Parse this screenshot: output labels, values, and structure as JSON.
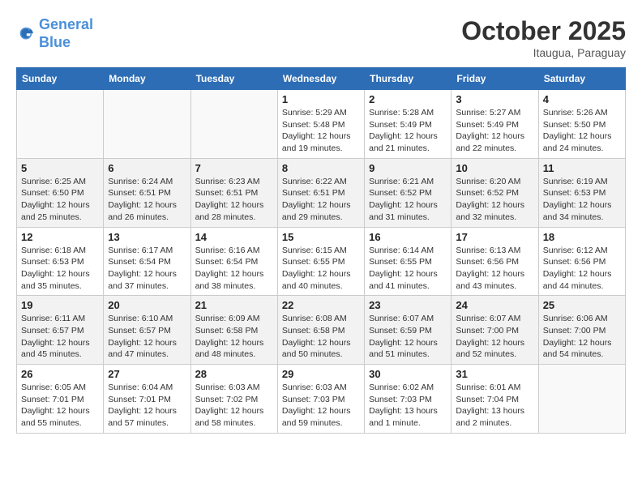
{
  "header": {
    "logo_line1": "General",
    "logo_line2": "Blue",
    "month": "October 2025",
    "location": "Itaugua, Paraguay"
  },
  "weekdays": [
    "Sunday",
    "Monday",
    "Tuesday",
    "Wednesday",
    "Thursday",
    "Friday",
    "Saturday"
  ],
  "weeks": [
    [
      {
        "num": "",
        "info": ""
      },
      {
        "num": "",
        "info": ""
      },
      {
        "num": "",
        "info": ""
      },
      {
        "num": "1",
        "info": "Sunrise: 5:29 AM\nSunset: 5:48 PM\nDaylight: 12 hours\nand 19 minutes."
      },
      {
        "num": "2",
        "info": "Sunrise: 5:28 AM\nSunset: 5:49 PM\nDaylight: 12 hours\nand 21 minutes."
      },
      {
        "num": "3",
        "info": "Sunrise: 5:27 AM\nSunset: 5:49 PM\nDaylight: 12 hours\nand 22 minutes."
      },
      {
        "num": "4",
        "info": "Sunrise: 5:26 AM\nSunset: 5:50 PM\nDaylight: 12 hours\nand 24 minutes."
      }
    ],
    [
      {
        "num": "5",
        "info": "Sunrise: 6:25 AM\nSunset: 6:50 PM\nDaylight: 12 hours\nand 25 minutes."
      },
      {
        "num": "6",
        "info": "Sunrise: 6:24 AM\nSunset: 6:51 PM\nDaylight: 12 hours\nand 26 minutes."
      },
      {
        "num": "7",
        "info": "Sunrise: 6:23 AM\nSunset: 6:51 PM\nDaylight: 12 hours\nand 28 minutes."
      },
      {
        "num": "8",
        "info": "Sunrise: 6:22 AM\nSunset: 6:51 PM\nDaylight: 12 hours\nand 29 minutes."
      },
      {
        "num": "9",
        "info": "Sunrise: 6:21 AM\nSunset: 6:52 PM\nDaylight: 12 hours\nand 31 minutes."
      },
      {
        "num": "10",
        "info": "Sunrise: 6:20 AM\nSunset: 6:52 PM\nDaylight: 12 hours\nand 32 minutes."
      },
      {
        "num": "11",
        "info": "Sunrise: 6:19 AM\nSunset: 6:53 PM\nDaylight: 12 hours\nand 34 minutes."
      }
    ],
    [
      {
        "num": "12",
        "info": "Sunrise: 6:18 AM\nSunset: 6:53 PM\nDaylight: 12 hours\nand 35 minutes."
      },
      {
        "num": "13",
        "info": "Sunrise: 6:17 AM\nSunset: 6:54 PM\nDaylight: 12 hours\nand 37 minutes."
      },
      {
        "num": "14",
        "info": "Sunrise: 6:16 AM\nSunset: 6:54 PM\nDaylight: 12 hours\nand 38 minutes."
      },
      {
        "num": "15",
        "info": "Sunrise: 6:15 AM\nSunset: 6:55 PM\nDaylight: 12 hours\nand 40 minutes."
      },
      {
        "num": "16",
        "info": "Sunrise: 6:14 AM\nSunset: 6:55 PM\nDaylight: 12 hours\nand 41 minutes."
      },
      {
        "num": "17",
        "info": "Sunrise: 6:13 AM\nSunset: 6:56 PM\nDaylight: 12 hours\nand 43 minutes."
      },
      {
        "num": "18",
        "info": "Sunrise: 6:12 AM\nSunset: 6:56 PM\nDaylight: 12 hours\nand 44 minutes."
      }
    ],
    [
      {
        "num": "19",
        "info": "Sunrise: 6:11 AM\nSunset: 6:57 PM\nDaylight: 12 hours\nand 45 minutes."
      },
      {
        "num": "20",
        "info": "Sunrise: 6:10 AM\nSunset: 6:57 PM\nDaylight: 12 hours\nand 47 minutes."
      },
      {
        "num": "21",
        "info": "Sunrise: 6:09 AM\nSunset: 6:58 PM\nDaylight: 12 hours\nand 48 minutes."
      },
      {
        "num": "22",
        "info": "Sunrise: 6:08 AM\nSunset: 6:58 PM\nDaylight: 12 hours\nand 50 minutes."
      },
      {
        "num": "23",
        "info": "Sunrise: 6:07 AM\nSunset: 6:59 PM\nDaylight: 12 hours\nand 51 minutes."
      },
      {
        "num": "24",
        "info": "Sunrise: 6:07 AM\nSunset: 7:00 PM\nDaylight: 12 hours\nand 52 minutes."
      },
      {
        "num": "25",
        "info": "Sunrise: 6:06 AM\nSunset: 7:00 PM\nDaylight: 12 hours\nand 54 minutes."
      }
    ],
    [
      {
        "num": "26",
        "info": "Sunrise: 6:05 AM\nSunset: 7:01 PM\nDaylight: 12 hours\nand 55 minutes."
      },
      {
        "num": "27",
        "info": "Sunrise: 6:04 AM\nSunset: 7:01 PM\nDaylight: 12 hours\nand 57 minutes."
      },
      {
        "num": "28",
        "info": "Sunrise: 6:03 AM\nSunset: 7:02 PM\nDaylight: 12 hours\nand 58 minutes."
      },
      {
        "num": "29",
        "info": "Sunrise: 6:03 AM\nSunset: 7:03 PM\nDaylight: 12 hours\nand 59 minutes."
      },
      {
        "num": "30",
        "info": "Sunrise: 6:02 AM\nSunset: 7:03 PM\nDaylight: 13 hours\nand 1 minute."
      },
      {
        "num": "31",
        "info": "Sunrise: 6:01 AM\nSunset: 7:04 PM\nDaylight: 13 hours\nand 2 minutes."
      },
      {
        "num": "",
        "info": ""
      }
    ]
  ]
}
